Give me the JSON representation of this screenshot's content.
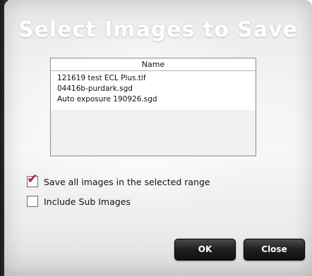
{
  "dialog": {
    "title": "Select Images to Save"
  },
  "file_list": {
    "header": "Name",
    "rows": [
      "121619 test ECL Plus.tif",
      "04416b-purdark.sgd",
      "Auto exposure 190926.sgd"
    ]
  },
  "options": {
    "save_all": {
      "label": "Save all images in the selected range",
      "checked": true
    },
    "include_sub": {
      "label": "Include Sub Images",
      "checked": false
    }
  },
  "buttons": {
    "ok_label": "OK",
    "close_label": "Close"
  },
  "colors": {
    "check_mark": "#c0223f",
    "button_bg": "#1f1f1f",
    "title_text": "#ffffff"
  }
}
